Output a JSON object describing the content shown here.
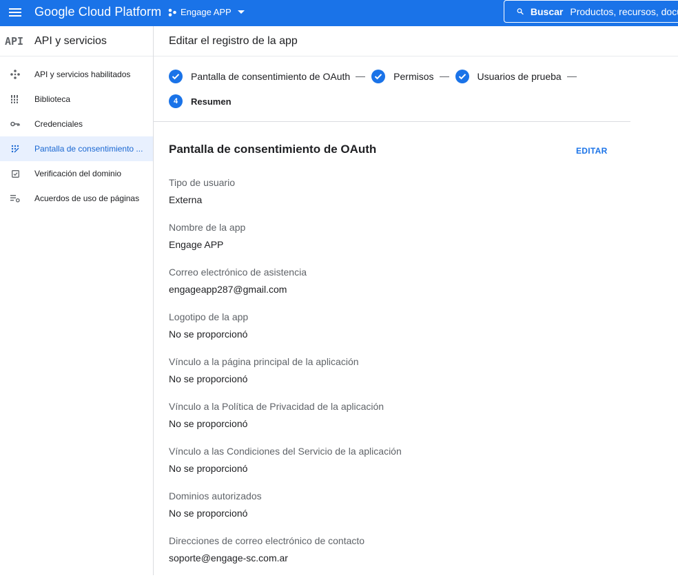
{
  "topbar": {
    "brand": "Google Cloud Platform",
    "project_name": "Engage APP",
    "search_label": "Buscar",
    "search_placeholder": "Productos, recursos, docu",
    "accent_color": "#1a73e8"
  },
  "sidebar": {
    "logo_text": "API",
    "title": "API y servicios",
    "items": [
      {
        "label": "API y servicios habilitados",
        "icon": "api-diamond-icon",
        "active": false
      },
      {
        "label": "Biblioteca",
        "icon": "library-icon",
        "active": false
      },
      {
        "label": "Credenciales",
        "icon": "key-icon",
        "active": false
      },
      {
        "label": "Pantalla de consentimiento ...",
        "icon": "consent-dots-icon",
        "active": true
      },
      {
        "label": "Verificación del dominio",
        "icon": "checkbox-icon",
        "active": false
      },
      {
        "label": "Acuerdos de uso de páginas",
        "icon": "list-settings-icon",
        "active": false
      }
    ]
  },
  "main": {
    "page_title": "Editar el registro de la app",
    "steps": [
      {
        "label": "Pantalla de consentimiento de OAuth",
        "status": "done"
      },
      {
        "label": "Permisos",
        "status": "done"
      },
      {
        "label": "Usuarios de prueba",
        "status": "done"
      },
      {
        "number": "4",
        "label": "Resumen",
        "status": "current"
      }
    ],
    "section_title": "Pantalla de consentimiento de OAuth",
    "edit_label": "EDITAR",
    "fields": [
      {
        "label": "Tipo de usuario",
        "value": "Externa"
      },
      {
        "label": "Nombre de la app",
        "value": "Engage APP"
      },
      {
        "label": "Correo electrónico de asistencia",
        "value": "engageapp287@gmail.com"
      },
      {
        "label": "Logotipo de la app",
        "value": "No se proporcionó"
      },
      {
        "label": "Vínculo a la página principal de la aplicación",
        "value": "No se proporcionó"
      },
      {
        "label": "Vínculo a la Política de Privacidad de la aplicación",
        "value": "No se proporcionó"
      },
      {
        "label": "Vínculo a las Condiciones del Servicio de la aplicación",
        "value": "No se proporcionó"
      },
      {
        "label": "Dominios autorizados",
        "value": "No se proporcionó"
      },
      {
        "label": "Direcciones de correo electrónico de contacto",
        "value": "soporte@engage-sc.com.ar"
      }
    ]
  }
}
